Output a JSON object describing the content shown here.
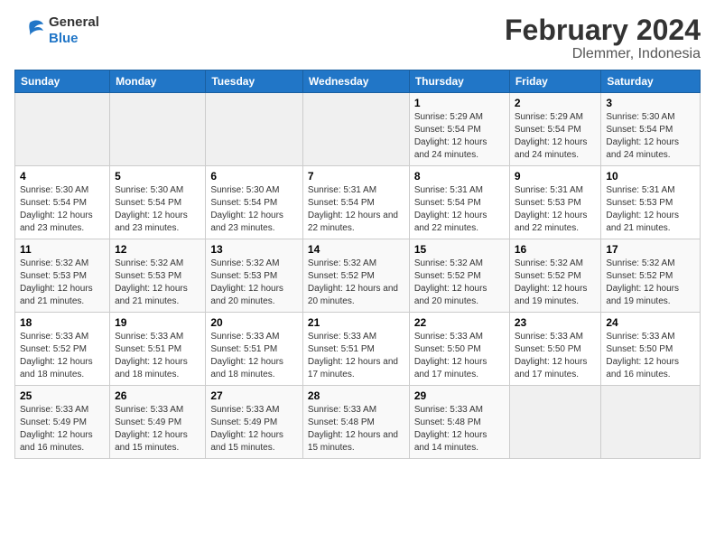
{
  "logo": {
    "line1": "General",
    "line2": "Blue"
  },
  "title": "February 2024",
  "subtitle": "Dlemmer, Indonesia",
  "days_of_week": [
    "Sunday",
    "Monday",
    "Tuesday",
    "Wednesday",
    "Thursday",
    "Friday",
    "Saturday"
  ],
  "weeks": [
    [
      {
        "day": "",
        "info": ""
      },
      {
        "day": "",
        "info": ""
      },
      {
        "day": "",
        "info": ""
      },
      {
        "day": "",
        "info": ""
      },
      {
        "day": "1",
        "info": "Sunrise: 5:29 AM\nSunset: 5:54 PM\nDaylight: 12 hours and 24 minutes."
      },
      {
        "day": "2",
        "info": "Sunrise: 5:29 AM\nSunset: 5:54 PM\nDaylight: 12 hours and 24 minutes."
      },
      {
        "day": "3",
        "info": "Sunrise: 5:30 AM\nSunset: 5:54 PM\nDaylight: 12 hours and 24 minutes."
      }
    ],
    [
      {
        "day": "4",
        "info": "Sunrise: 5:30 AM\nSunset: 5:54 PM\nDaylight: 12 hours and 23 minutes."
      },
      {
        "day": "5",
        "info": "Sunrise: 5:30 AM\nSunset: 5:54 PM\nDaylight: 12 hours and 23 minutes."
      },
      {
        "day": "6",
        "info": "Sunrise: 5:30 AM\nSunset: 5:54 PM\nDaylight: 12 hours and 23 minutes."
      },
      {
        "day": "7",
        "info": "Sunrise: 5:31 AM\nSunset: 5:54 PM\nDaylight: 12 hours and 22 minutes."
      },
      {
        "day": "8",
        "info": "Sunrise: 5:31 AM\nSunset: 5:54 PM\nDaylight: 12 hours and 22 minutes."
      },
      {
        "day": "9",
        "info": "Sunrise: 5:31 AM\nSunset: 5:53 PM\nDaylight: 12 hours and 22 minutes."
      },
      {
        "day": "10",
        "info": "Sunrise: 5:31 AM\nSunset: 5:53 PM\nDaylight: 12 hours and 21 minutes."
      }
    ],
    [
      {
        "day": "11",
        "info": "Sunrise: 5:32 AM\nSunset: 5:53 PM\nDaylight: 12 hours and 21 minutes."
      },
      {
        "day": "12",
        "info": "Sunrise: 5:32 AM\nSunset: 5:53 PM\nDaylight: 12 hours and 21 minutes."
      },
      {
        "day": "13",
        "info": "Sunrise: 5:32 AM\nSunset: 5:53 PM\nDaylight: 12 hours and 20 minutes."
      },
      {
        "day": "14",
        "info": "Sunrise: 5:32 AM\nSunset: 5:52 PM\nDaylight: 12 hours and 20 minutes."
      },
      {
        "day": "15",
        "info": "Sunrise: 5:32 AM\nSunset: 5:52 PM\nDaylight: 12 hours and 20 minutes."
      },
      {
        "day": "16",
        "info": "Sunrise: 5:32 AM\nSunset: 5:52 PM\nDaylight: 12 hours and 19 minutes."
      },
      {
        "day": "17",
        "info": "Sunrise: 5:32 AM\nSunset: 5:52 PM\nDaylight: 12 hours and 19 minutes."
      }
    ],
    [
      {
        "day": "18",
        "info": "Sunrise: 5:33 AM\nSunset: 5:52 PM\nDaylight: 12 hours and 18 minutes."
      },
      {
        "day": "19",
        "info": "Sunrise: 5:33 AM\nSunset: 5:51 PM\nDaylight: 12 hours and 18 minutes."
      },
      {
        "day": "20",
        "info": "Sunrise: 5:33 AM\nSunset: 5:51 PM\nDaylight: 12 hours and 18 minutes."
      },
      {
        "day": "21",
        "info": "Sunrise: 5:33 AM\nSunset: 5:51 PM\nDaylight: 12 hours and 17 minutes."
      },
      {
        "day": "22",
        "info": "Sunrise: 5:33 AM\nSunset: 5:50 PM\nDaylight: 12 hours and 17 minutes."
      },
      {
        "day": "23",
        "info": "Sunrise: 5:33 AM\nSunset: 5:50 PM\nDaylight: 12 hours and 17 minutes."
      },
      {
        "day": "24",
        "info": "Sunrise: 5:33 AM\nSunset: 5:50 PM\nDaylight: 12 hours and 16 minutes."
      }
    ],
    [
      {
        "day": "25",
        "info": "Sunrise: 5:33 AM\nSunset: 5:49 PM\nDaylight: 12 hours and 16 minutes."
      },
      {
        "day": "26",
        "info": "Sunrise: 5:33 AM\nSunset: 5:49 PM\nDaylight: 12 hours and 15 minutes."
      },
      {
        "day": "27",
        "info": "Sunrise: 5:33 AM\nSunset: 5:49 PM\nDaylight: 12 hours and 15 minutes."
      },
      {
        "day": "28",
        "info": "Sunrise: 5:33 AM\nSunset: 5:48 PM\nDaylight: 12 hours and 15 minutes."
      },
      {
        "day": "29",
        "info": "Sunrise: 5:33 AM\nSunset: 5:48 PM\nDaylight: 12 hours and 14 minutes."
      },
      {
        "day": "",
        "info": ""
      },
      {
        "day": "",
        "info": ""
      }
    ]
  ]
}
